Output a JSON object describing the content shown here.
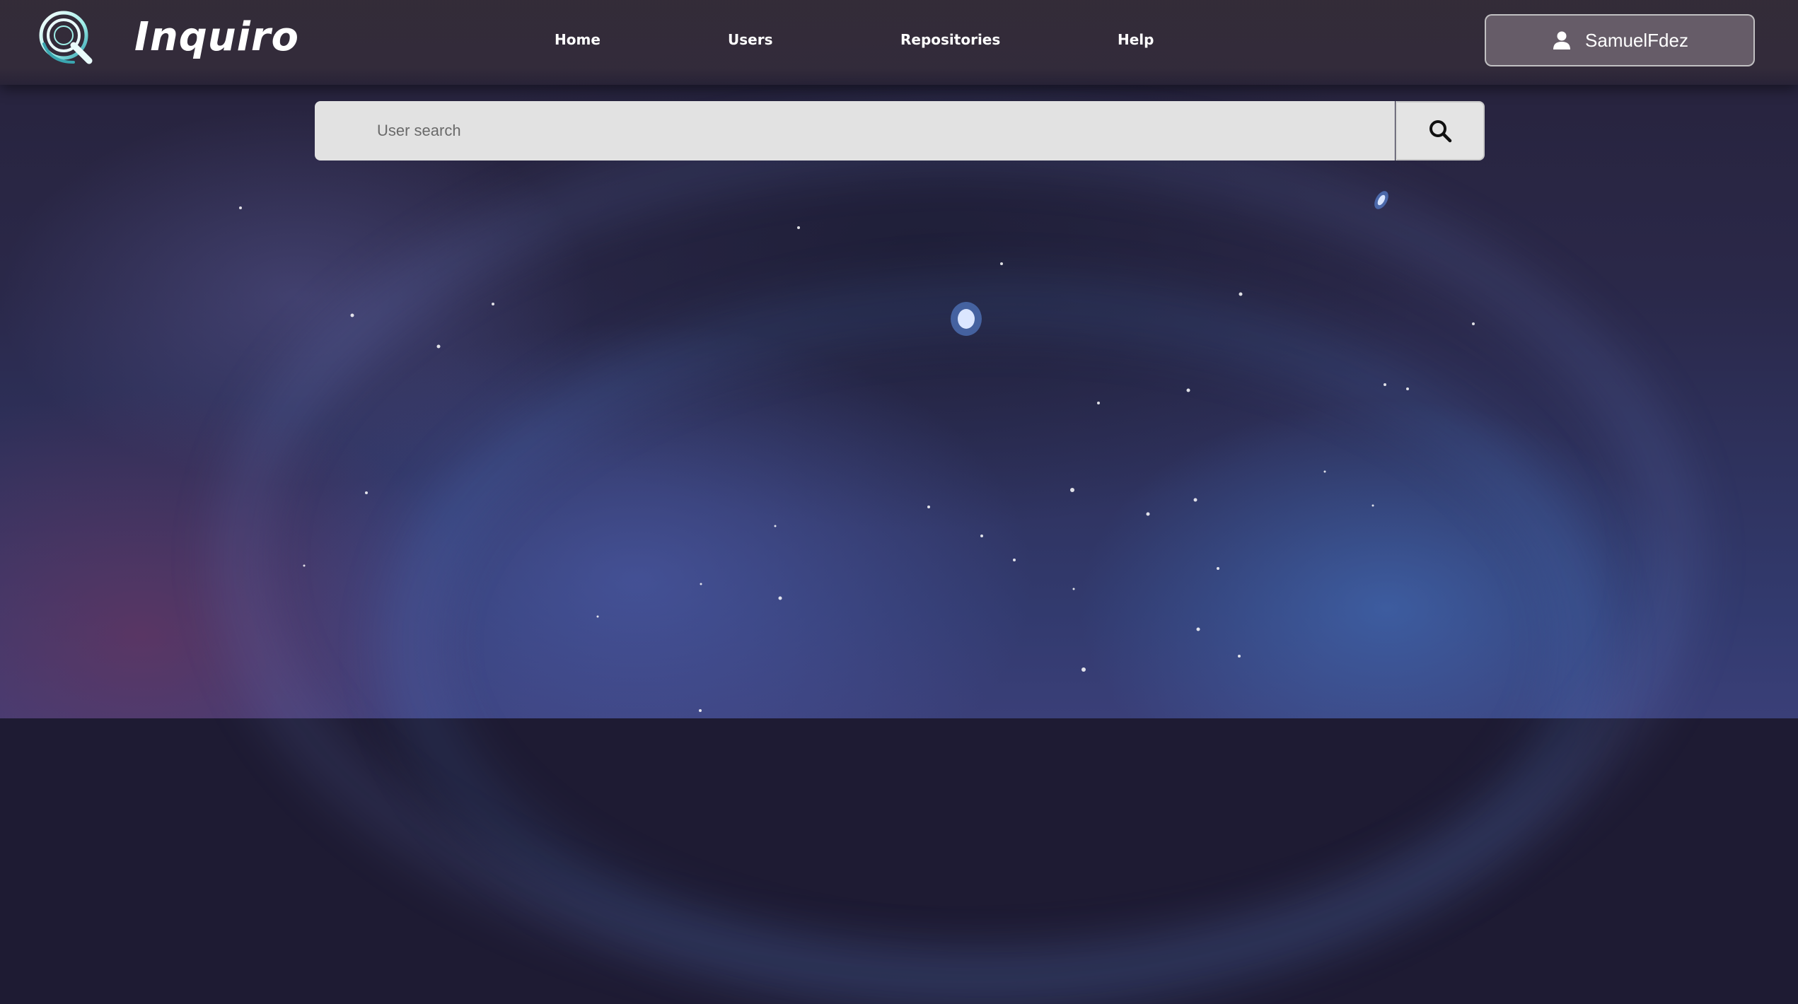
{
  "brand": {
    "name": "Inquiro",
    "logo_icon": "magnifier-ring-logo-icon",
    "accent_colors": [
      "#7fe3e0",
      "#3aa6b0",
      "#ffffff"
    ]
  },
  "nav": {
    "links": [
      {
        "label": "Home"
      },
      {
        "label": "Users"
      },
      {
        "label": "Repositories"
      },
      {
        "label": "Help"
      }
    ]
  },
  "user": {
    "icon": "user-icon",
    "name": "SamuelFdez"
  },
  "search": {
    "placeholder": "User search",
    "value": "",
    "button_icon": "search-icon"
  },
  "theme": {
    "header_bg": "#342c38",
    "search_bg": "#e2e2e2",
    "text_color": "#ffffff"
  }
}
